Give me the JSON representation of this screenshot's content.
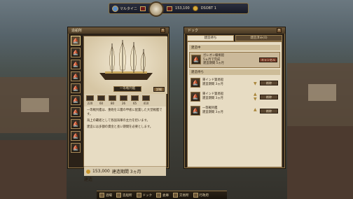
{
  "top_bar": {
    "player_name": "マルタイニ",
    "gold_label": "153,100",
    "fame_label": "DSOBT 1",
    "stat_icon_1": "ship-icon",
    "stat_icon_2": "coin-icon"
  },
  "left_panel": {
    "title": "造船所",
    "ship_name": "一等戦列艦",
    "ship_button": "詳細",
    "stats": [
      "220",
      "60",
      "80",
      "26",
      "65",
      "410"
    ],
    "description": [
      "一等戦列艦は、重砲を三層の甲板に配置した大型戦艦です。",
      "海上の覇者として各国海軍の主力を担います。",
      "建造には多額の資金と長い期間を必要とします。"
    ],
    "footer_cost": "153,000",
    "footer_days": "建造期間 3ヵ月",
    "ok_button": "建造"
  },
  "right_panel": {
    "title": "ドック",
    "tabs": [
      "建造待ち",
      "建造済み(0)"
    ],
    "section_in_progress": "建造中",
    "section_waiting": "建造待ち",
    "items": [
      {
        "name": "ガレオン級帆船",
        "sub": "5ヵ月で完成",
        "detail": "建造期間 5ヵ月",
        "button": "キャンセル"
      },
      {
        "name": "東インド貿易船",
        "sub": "建造期間 3ヵ月",
        "detail": "",
        "button": "削除"
      },
      {
        "name": "東インド貿易船",
        "sub": "建造期間 3ヵ月",
        "detail": "",
        "button": "削除"
      },
      {
        "name": "一等戦列艦",
        "sub": "建造期間 3ヵ月",
        "detail": "",
        "button": "削除"
      }
    ]
  },
  "bottom_bar": {
    "items": [
      "酒場",
      "造船所",
      "ドック",
      "倉庫",
      "交易所",
      "行政府"
    ]
  }
}
